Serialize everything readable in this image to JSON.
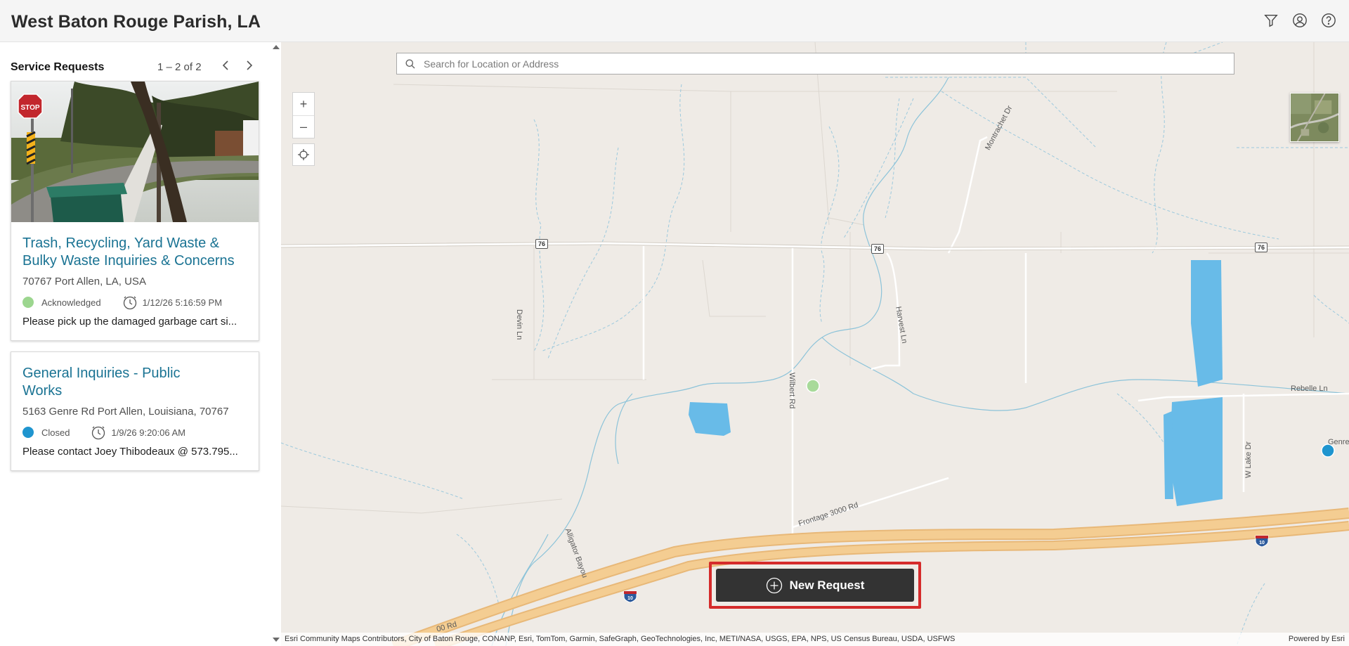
{
  "app": {
    "title": "West Baton Rouge Parish, LA"
  },
  "header": {
    "icons": [
      "filter-icon",
      "user-icon",
      "help-icon"
    ]
  },
  "sidebar": {
    "title": "Service Requests",
    "pager": "1 – 2 of 2",
    "cards": [
      {
        "title": "Trash, Recycling, Yard Waste & Bulky Waste Inquiries & Concerns",
        "address": "70767 Port Allen, LA, USA",
        "status": "Acknowledged",
        "status_color": "#9cd68f",
        "timestamp": "1/12/26 5:16:59 PM",
        "description": "Please pick up the damaged garbage cart si..."
      },
      {
        "title": "General Inquiries - Public Works",
        "address": "5163 Genre Rd Port Allen, Louisiana, 70767",
        "status": "Closed",
        "status_color": "#1f95cf",
        "timestamp": "1/9/26 9:20:06 AM",
        "description": "Please contact Joey Thibodeaux @ 573.795..."
      }
    ]
  },
  "map": {
    "search_placeholder": "Search for Location or Address",
    "zoom_in": "+",
    "zoom_out": "–",
    "new_request_label": "New Request",
    "attribution": "Esri Community Maps Contributors, City of Baton Rouge, CONANP, Esri, TomTom, Garmin, SafeGraph, GeoTechnologies, Inc, METI/NASA, USGS, EPA, NPS, US Census Bureau, USDA, USFWS",
    "powered_by": "Powered by Esri",
    "labels": {
      "montrachet": "Montrachet Dr",
      "devin": "Devin Ln",
      "harvest": "Harvest Ln",
      "wilbert": "Wilbert Rd",
      "rebelle": "Rebelle Ln",
      "wlake": "W Lake Dr",
      "frontage": "Frontage 3000 Rd",
      "alligator": "Alligator Bayou",
      "genre": "Genre R",
      "rd_cut": "00 Rd"
    },
    "route_76": "76",
    "route_10": "10"
  }
}
